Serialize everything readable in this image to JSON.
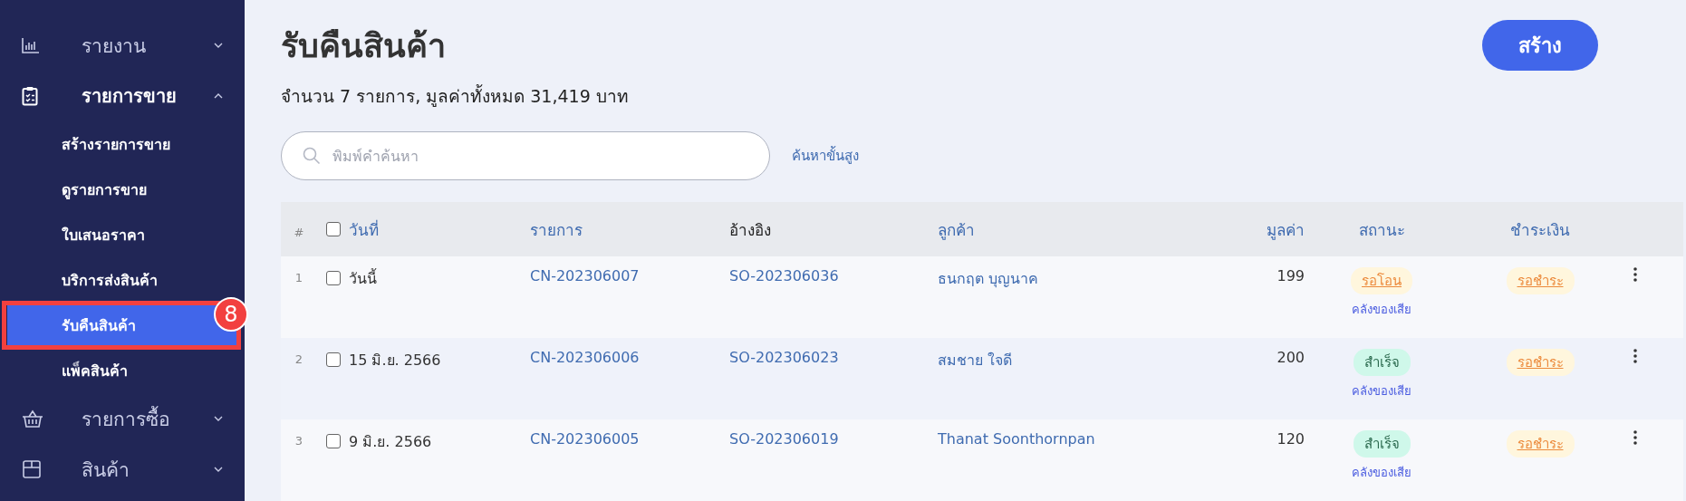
{
  "sidebar": {
    "groups": [
      {
        "label": "รายงาน",
        "expanded": false
      },
      {
        "label": "รายการขาย",
        "expanded": true,
        "children": [
          {
            "label": "สร้างรายการขาย",
            "selected": false
          },
          {
            "label": "ดูรายการขาย",
            "selected": false
          },
          {
            "label": "ใบเสนอราคา",
            "selected": false
          },
          {
            "label": "บริการส่งสินค้า",
            "selected": false
          },
          {
            "label": "รับคืนสินค้า",
            "selected": true,
            "annotation": "8"
          },
          {
            "label": "แพ็คสินค้า",
            "selected": false
          }
        ]
      },
      {
        "label": "รายการซื้อ",
        "expanded": false
      },
      {
        "label": "สินค้า",
        "expanded": false
      }
    ]
  },
  "page": {
    "title": "รับคืนสินค้า",
    "summary": "จำนวน 7 รายการ, มูลค่าทั้งหมด 31,419 บาท",
    "create_button": "สร้าง"
  },
  "search": {
    "placeholder": "พิมพ์คำค้นหา",
    "advanced_link": "ค้นหาขั้นสูง"
  },
  "table": {
    "columns": [
      "#",
      "วันที่",
      "รายการ",
      "อ้างอิง",
      "ลูกค้า",
      "มูลค่า",
      "สถานะ",
      "ชำระเงิน"
    ],
    "select_all_checked": false,
    "rows": [
      {
        "index": "1",
        "checked": false,
        "date": "วันนี้",
        "document": "CN-202306007",
        "reference": "SO-202306036",
        "customer": "ธนกฤต บุญนาค",
        "value": "199",
        "status": {
          "label": "รอโอน",
          "kind": "pending"
        },
        "warehouse": "คลังของเสีย",
        "payment": {
          "label": "รอชำระ",
          "kind": "pending"
        }
      },
      {
        "index": "2",
        "checked": false,
        "date": "15 มิ.ย. 2566",
        "document": "CN-202306006",
        "reference": "SO-202306023",
        "customer": "สมชาย ใจดี",
        "value": "200",
        "status": {
          "label": "สำเร็จ",
          "kind": "success"
        },
        "warehouse": "คลังของเสีย",
        "payment": {
          "label": "รอชำระ",
          "kind": "pending"
        }
      },
      {
        "index": "3",
        "checked": false,
        "date": "9 มิ.ย. 2566",
        "document": "CN-202306005",
        "reference": "SO-202306019",
        "customer": "Thanat Soonthornpan",
        "value": "120",
        "status": {
          "label": "สำเร็จ",
          "kind": "success"
        },
        "warehouse": "คลังของเสีย",
        "payment": {
          "label": "รอชำระ",
          "kind": "pending"
        }
      }
    ]
  }
}
